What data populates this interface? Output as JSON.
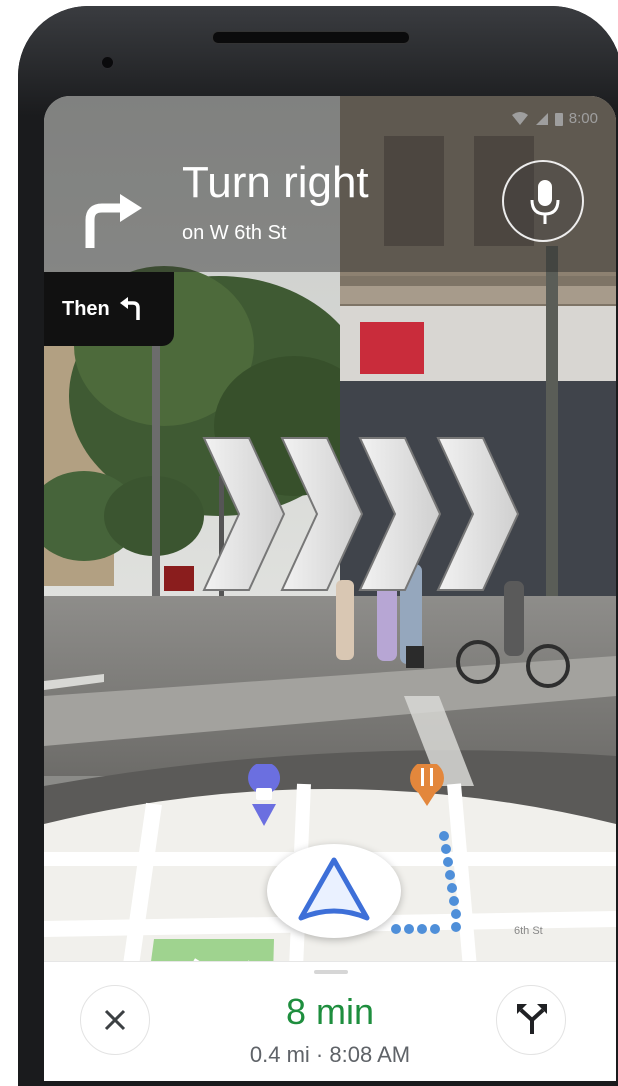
{
  "status_bar": {
    "time": "8:00"
  },
  "navigation": {
    "instruction": "Turn right",
    "street": "on W 6th St",
    "then_label": "Then"
  },
  "map": {
    "street_label": "6th St"
  },
  "trip": {
    "eta": "8 min",
    "details": "0.4 mi · 8:08 AM"
  },
  "colors": {
    "eta_green": "#1e8e3e",
    "route_blue": "#4f8fd9",
    "arrow_blue": "#3d6fd8"
  },
  "icons": [
    "turn-right-icon",
    "mic-icon",
    "turn-left-icon",
    "shopping-pin-icon",
    "restaurant-pin-icon",
    "navigation-arrow-icon",
    "close-icon",
    "alternate-routes-icon"
  ]
}
